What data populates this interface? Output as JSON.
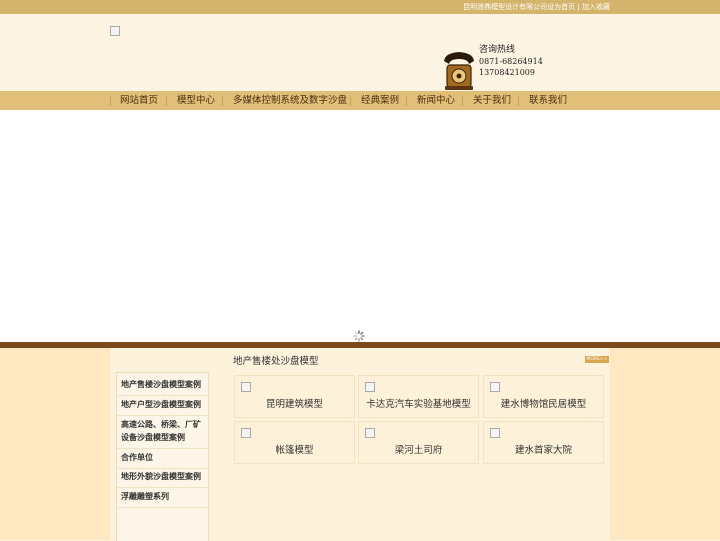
{
  "topbar": {
    "links": [
      "昆明浪鼎模型设计有限公司设为首页",
      "加入收藏"
    ],
    "separator": "|"
  },
  "header": {
    "logo_icon": "broken-image-icon",
    "hotline_title": "咨询热线",
    "phone1": "0871-68264914",
    "phone2": "13708421009",
    "phone_icon": "telephone-icon"
  },
  "nav": {
    "items": [
      "网站首页",
      "模型中心",
      "多媒体控制系统及数字沙盘",
      "经典案例",
      "新闻中心",
      "关于我们",
      "联系我们"
    ]
  },
  "banner": {
    "loading_icon": "spinner-icon"
  },
  "section": {
    "title": "地产售楼处沙盘模型",
    "more_label": "MORE>>"
  },
  "sidebar": {
    "items": [
      "地产售楼沙盘模型案例",
      "地产户型沙盘模型案例",
      "高速公路、桥梁、厂矿设备沙盘模型案例",
      "合作单位",
      "地形外貌沙盘模型案例",
      "浮雕雕塑系列"
    ]
  },
  "products": [
    {
      "caption": "昆明建筑模型"
    },
    {
      "caption": "卡达克汽车实验基地模型"
    },
    {
      "caption": "建水博物馆民居模型"
    },
    {
      "caption": "帐篷模型"
    },
    {
      "caption": "梁河土司府"
    },
    {
      "caption": "建水首家大院"
    }
  ],
  "colors": {
    "topbar": "#d4b36a",
    "nav": "#e2bf78",
    "divider": "#7c4a1a",
    "more_badge": "#d9a650"
  }
}
